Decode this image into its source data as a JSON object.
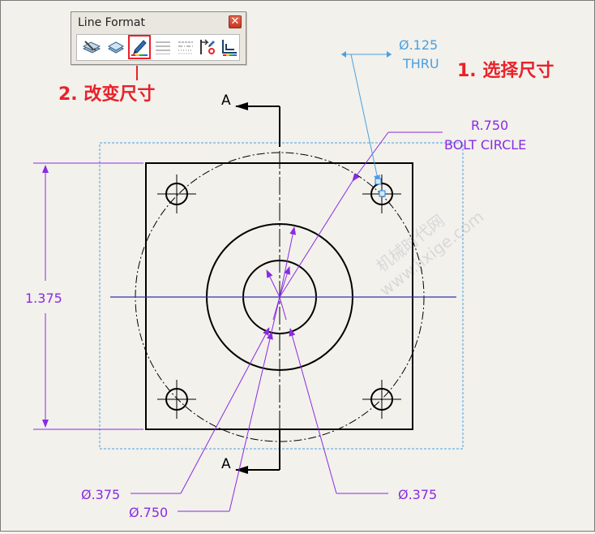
{
  "window": {
    "title": "Line Format",
    "close_glyph": "✕",
    "tools": [
      {
        "name": "layer-properties-icon"
      },
      {
        "name": "line-color-icon"
      },
      {
        "name": "line-thickness-icon"
      },
      {
        "name": "line-style-icon"
      },
      {
        "name": "hide-show-edges-icon"
      },
      {
        "name": "color-display-mode-icon"
      },
      {
        "name": "grid-display-icon"
      }
    ]
  },
  "annotations": {
    "step1": "1. 选择尺寸",
    "step2": "2. 改变尺寸",
    "highlight_color": "#e8222a"
  },
  "drawing": {
    "section_label_top": "A",
    "section_label_bottom": "A",
    "hole_callout_size": "Ø.125",
    "hole_callout_type": "THRU",
    "radius_dim": "R.750",
    "radius_note": "BOLT CIRCLE",
    "height_dim": "1.375",
    "dia_left": "Ø.375",
    "dia_bottom": "Ø.750",
    "dia_right": "Ø.375",
    "dimension_color": "#8a2be2",
    "note_color": "#4aa0e0"
  },
  "watermark": {
    "line1": "机械时代网",
    "line2": "www.jixige.com"
  }
}
